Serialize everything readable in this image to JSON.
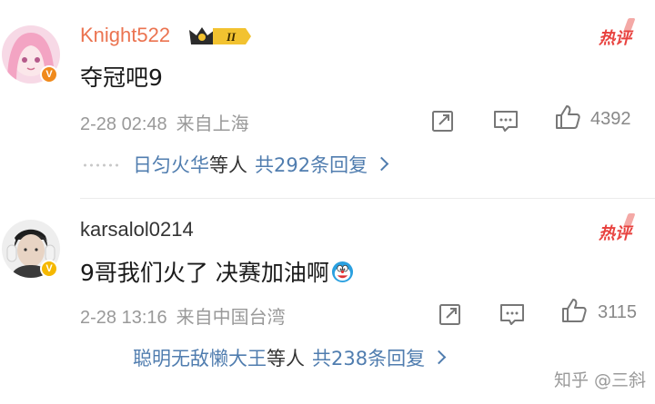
{
  "comments": [
    {
      "username": "Knight522",
      "level_badge": "II",
      "hot_label": "热评",
      "content": "夺冠吧9",
      "time": "2-28 02:48",
      "location": "来自上海",
      "like_count": "4392",
      "replies": {
        "who": "日匀火华",
        "etc": "等人",
        "total": "共292条回复"
      },
      "name_color": "#eb7350"
    },
    {
      "username": "karsalol0214",
      "hot_label": "热评",
      "content": "9哥我们火了 决赛加油啊",
      "emoji": "doraemon-emoji",
      "time": "2-28 13:16",
      "location": "来自中国台湾",
      "like_count": "3115",
      "replies": {
        "who": "聪明无敌懒大王",
        "etc": "等人",
        "total": "共238条回复"
      },
      "name_color": "#333333"
    }
  ],
  "watermark": "知乎 @三斜",
  "icons": [
    "share-icon",
    "comment-icon",
    "like-icon",
    "chevron-right-icon",
    "vip-badge-icon",
    "crown-icon"
  ],
  "colors": {
    "link": "#507daf",
    "hot": "#e8423f",
    "meta": "#999999"
  }
}
